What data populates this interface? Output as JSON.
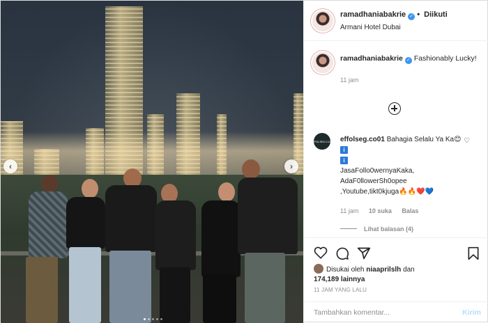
{
  "header": {
    "username": "ramadhaniabakrie",
    "follow_status": "Diikuti",
    "location": "Armani Hotel Dubai",
    "separator": "•"
  },
  "caption": {
    "username": "ramadhaniabakrie",
    "text": "Fashionably Lucky!",
    "time": "11 jam"
  },
  "comment": {
    "username": "effolseg.co01",
    "avatar_text": "EFFOLSEG.CO01",
    "text_line1": "Bahagia Selalu Ya Ka",
    "text_line2": "JasaFollo0wernyaKaka,",
    "text_line3": "AdaF0llowerSh0opee",
    "text_line4": ",Youtube,tikt0kjuga",
    "emoji_smile": "😊",
    "emoji_tail": "🔥🔥❤️💙",
    "info_badge": "i",
    "time": "11 jam",
    "likes": "10 suka",
    "reply": "Balas",
    "view_replies": "Lihat balasan (4)"
  },
  "likes": {
    "prefix": "Disukai oleh",
    "user": "niaaprilslh",
    "middle": "dan",
    "count": "174,189 lainnya"
  },
  "posted_time": "11 JAM YANG LALU",
  "add_comment": {
    "placeholder": "Tambahkan komentar...",
    "post_label": "Kirim"
  },
  "icons": {
    "verified": "verified-icon",
    "like": "heart-icon",
    "comment": "comment-icon",
    "share": "share-icon",
    "save": "bookmark-icon",
    "load_more": "plus-circle-icon"
  },
  "colors": {
    "verified_blue": "#3897f0",
    "post_button_disabled": "#b2dffc",
    "secondary_text": "#8e8e8e"
  },
  "carousel": {
    "prev_glyph": "‹",
    "next_glyph": "›"
  }
}
